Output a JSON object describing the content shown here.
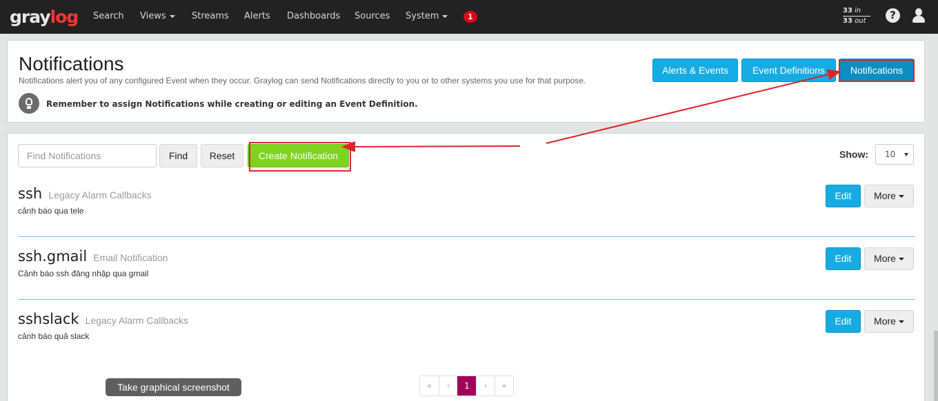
{
  "navbar": {
    "logo_part1": "gray",
    "logo_part2": "log",
    "items": [
      "Search",
      "Views",
      "Streams",
      "Alerts",
      "Dashboards",
      "Sources",
      "System"
    ],
    "alerts_badge": "1",
    "throughput_in_value": "33",
    "throughput_in_label": "in",
    "throughput_out_value": "33",
    "throughput_out_label": "out",
    "help_symbol": "?"
  },
  "header": {
    "title": "Notifications",
    "description": "Notifications alert you of any configured Event when they occur. Graylog can send Notifications directly to you or to other systems you use for that purpose.",
    "hint": "Remember to assign Notifications while creating or editing an Event Definition.",
    "tabs": [
      "Alerts & Events",
      "Event Definitions",
      "Notifications"
    ],
    "active_tab": "Notifications"
  },
  "toolbar": {
    "search_placeholder": "Find Notifications",
    "find_label": "Find",
    "reset_label": "Reset",
    "create_label": "Create Notification",
    "show_label": "Show:",
    "show_value": "10"
  },
  "notifications": [
    {
      "title": "ssh",
      "type": "Legacy Alarm Callbacks",
      "description": "cảnh báo qua tele"
    },
    {
      "title": "ssh.gmail",
      "type": "Email Notification",
      "description": "Cảnh báo ssh đăng nhập qua gmail"
    },
    {
      "title": "sshslack",
      "type": "Legacy Alarm Callbacks",
      "description": "cảnh báo quả slack"
    }
  ],
  "row_actions": {
    "edit_label": "Edit",
    "more_label": "More"
  },
  "pagination": {
    "first": "«",
    "prev": "‹",
    "current": "1",
    "next": "›",
    "last": "»"
  },
  "tooltip": "Take graphical screenshot",
  "colors": {
    "navbar_bg": "#222222",
    "accent_info": "#16ace3",
    "accent_success": "#7ed321",
    "pagination_active": "#a0005a",
    "annotation_red": "#e0222a",
    "badge_red": "#e1001a"
  }
}
